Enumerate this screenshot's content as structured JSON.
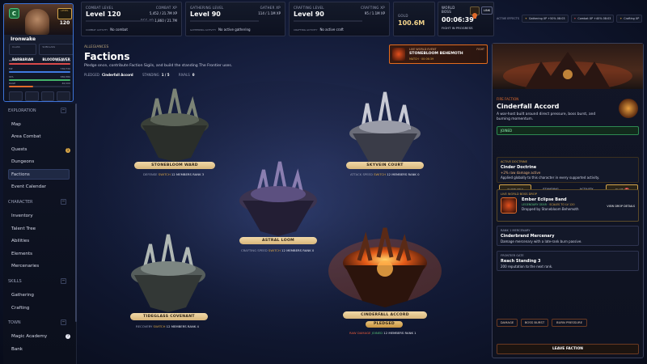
{
  "character": {
    "grade": "C",
    "level_label": "LEVEL",
    "level": "120",
    "name": "Ironwake",
    "class_label": "CLASS",
    "class": "BARBARIAN",
    "subclass_label": "SUBCLASS",
    "subclass": "BLOODWEAVER",
    "stats": [
      {
        "label": "HP",
        "value": "6,939/6,939",
        "fill": 1.0,
        "color": "#d94a4a"
      },
      {
        "label": "MP",
        "value": "730/730",
        "fill": 1.0,
        "color": "#3f7ae0"
      },
      {
        "label": "STA",
        "value": "380/380",
        "fill": 1.0,
        "color": "#44b36a"
      },
      {
        "label": "RAGE",
        "value": "40/100",
        "fill": 0.4,
        "color": "#e06a2a"
      }
    ]
  },
  "skills": [
    {
      "level_label": "COMBAT LEVEL",
      "level": "Level 120",
      "xp_label": "COMBAT XP",
      "xp": "5,452 / 21.7M XP",
      "xp2_label": "RES XP",
      "xp2": "1,860 / 21.7M",
      "activity_label": "COMBAT ACTIVITY",
      "activity": "No combat",
      "xp_fill": 0.001
    },
    {
      "level_label": "GATHERING LEVEL",
      "level": "Level 90",
      "xp_label": "GATHER XP",
      "xp": "114 / 1.1M XP",
      "xp2_label": "",
      "xp2": "",
      "activity_label": "GATHERING ACTIVITY",
      "activity": "No active gathering",
      "xp_fill": 0.001
    },
    {
      "level_label": "CRAFTING LEVEL",
      "level": "Level 90",
      "xp_label": "CRAFTING XP",
      "xp": "95 / 1.1M XP",
      "xp2_label": "",
      "xp2": "",
      "activity_label": "CRAFTING ACTIVITY",
      "activity": "No active craft",
      "xp_fill": 0.001
    }
  ],
  "gold": {
    "label": "GOLD",
    "value": "100.6M"
  },
  "boss": {
    "label": "WORLD BOSS",
    "timer": "00:06:39",
    "status": "FIGHT IN PROGRESS",
    "link": "LINK"
  },
  "effects": {
    "label": "ACTIVE EFFECTS",
    "items": [
      "Gathering XP +50%  08:03",
      "Combat XP +40%  08:03",
      "Crafting XP"
    ]
  },
  "sidebar": {
    "sections": [
      {
        "label": "EXPLORATION",
        "items": [
          "Map",
          "Area Combat",
          "Quests",
          "Dungeons",
          "Factions",
          "Event Calendar"
        ]
      },
      {
        "label": "CHARACTER",
        "items": [
          "Inventory",
          "Talent Tree",
          "Abilities",
          "Elements",
          "Mercenaries"
        ]
      },
      {
        "label": "SKILLS",
        "items": [
          "Gathering",
          "Crafting"
        ]
      },
      {
        "label": "TOWN",
        "items": [
          "Magic Academy",
          "Bank"
        ]
      }
    ],
    "quests_badge": "1",
    "academy_badge": "?"
  },
  "main": {
    "subtitle": "ALLEGIANCES",
    "title": "Factions",
    "description": "Pledge once, contribute Faction Sigils, and build the standing The Frontier uses.",
    "pledged_label": "PLEDGED",
    "pledged": "Cinderfall Accord",
    "standing_label": "STANDING",
    "standing": "1 / 5",
    "rivals_label": "RIVALS",
    "rivals": "0"
  },
  "world_banner": {
    "label": "LIVE WORLD EVENT",
    "title": "STONEBLOOM BEHEMOTH",
    "sub": "MATCH · 00:06:39",
    "tag": "FIGHT"
  },
  "factions": [
    {
      "name": "STONEBLOOM WARD",
      "stat": "DEFENSE",
      "action": "SWITCH",
      "members": "12 MEMBERS",
      "rank": "RANK 3"
    },
    {
      "name": "SKYVEIN COURT",
      "stat": "ATTACK SPEED",
      "action": "SWITCH",
      "members": "12 MEMBERS",
      "rank": "RANK 0"
    },
    {
      "name": "ASTRAL LOOM",
      "stat": "CRAFTING SPEED",
      "action": "SWITCH",
      "members": "12 MEMBERS",
      "rank": "RANK 0"
    },
    {
      "name": "TIDEGLASS COVENANT",
      "stat": "RECOVERY",
      "action": "SWITCH",
      "members": "12 MEMBERS",
      "rank": "RANK 4"
    },
    {
      "name": "CINDERFALL ACCORD",
      "stat": "RAW DAMAGE",
      "action": "JOINED",
      "members": "12 MEMBERS",
      "rank": "RANK 1",
      "pledged": "PLEDGED"
    }
  ],
  "detail": {
    "kicker": "FIRE FACTION",
    "name": "Cinderfall Accord",
    "description": "A war-host built around direct pressure, boss burst, and burning momentum.",
    "status": "JOINED",
    "tabs": [
      "OVERVIEW",
      "STANDING",
      "ACTIVITY",
      "CHAT"
    ],
    "chat_badge": "1",
    "doctrine": {
      "label": "ACTIVE DOCTRINE",
      "name": "Cinder Doctrine",
      "bonus": "+2% raw damage active",
      "note": "Applied globally to this character in every supported activity."
    },
    "shop": {
      "label": "LIVE WORLD BOSS DROP",
      "name": "Ember Eclipse Band",
      "rarity": "LEGENDARY GEAR",
      "scale": "SCALES TO LV 120",
      "drop": "Dropped by Stonebloom Behemoth",
      "link": "VIEW DROP DETAILS"
    },
    "merc": {
      "label": "RANK 1 MERCENARY",
      "name": "Cinderbrand Mercenary",
      "note": "Damage mercenary with a late-rank burn passive."
    },
    "frontier": {
      "label": "FRONTIER GATE",
      "name": "Reach Standing 3",
      "note": "200 reputation to the next rank."
    },
    "tags": [
      "DAMAGE",
      "BOSS BURST",
      "BURN PRESSURE"
    ],
    "leave": "LEAVE FACTION"
  }
}
